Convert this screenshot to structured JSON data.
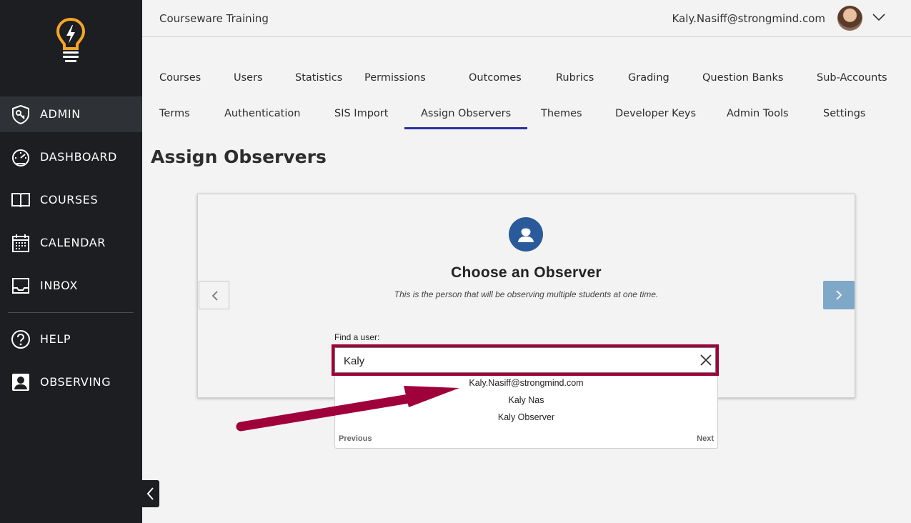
{
  "sidebar": {
    "items": [
      {
        "key": "admin",
        "label": "ADMIN",
        "icon": "shield-key-icon",
        "active": true
      },
      {
        "key": "dashboard",
        "label": "DASHBOARD",
        "icon": "speedometer-icon"
      },
      {
        "key": "courses",
        "label": "COURSES",
        "icon": "book-icon"
      },
      {
        "key": "calendar",
        "label": "CALENDAR",
        "icon": "calendar-icon"
      },
      {
        "key": "inbox",
        "label": "INBOX",
        "icon": "inbox-icon"
      },
      {
        "key": "help",
        "label": "HELP",
        "icon": "help-icon"
      },
      {
        "key": "observing",
        "label": "OBSERVING",
        "icon": "observer-icon"
      }
    ]
  },
  "header": {
    "account_title": "Courseware Training",
    "user_email": "Kaly.Nasiff@strongmind.com"
  },
  "tabs": {
    "row1": [
      "Courses",
      "Users",
      "Statistics",
      "Permissions",
      "Outcomes",
      "Rubrics",
      "Grading",
      "Question Banks",
      "Sub-Accounts"
    ],
    "row2": [
      "Terms",
      "Authentication",
      "SIS Import",
      "Assign Observers",
      "Themes",
      "Developer Keys",
      "Admin Tools",
      "Settings"
    ],
    "active": "Assign Observers"
  },
  "page": {
    "title": "Assign Observers"
  },
  "card": {
    "title": "Choose an Observer",
    "subtitle": "This is the person that will be observing multiple students at one time.",
    "find_label": "Find a user:",
    "search_value": "Kaly"
  },
  "dropdown": {
    "results": [
      "Kaly.Nasiff@strongmind.com",
      "Kaly Nas",
      "Kaly Observer"
    ],
    "prev_label": "Previous",
    "next_label": "Next"
  },
  "colors": {
    "sidebar_bg": "#1c1e21",
    "accent": "#2a2f9e",
    "highlight": "#a0003a",
    "logo": "#f5a623",
    "next_button": "#7fa7c8"
  }
}
